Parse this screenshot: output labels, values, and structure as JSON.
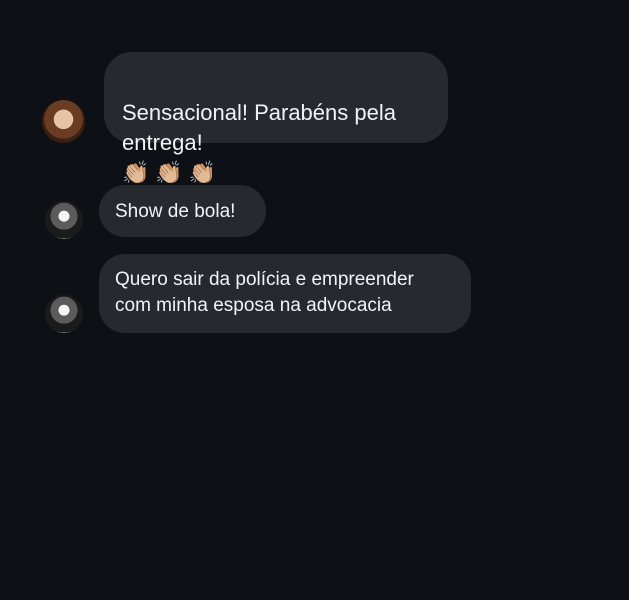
{
  "messages": [
    {
      "text": "Sensacional! Parabéns pela\nentrega!",
      "emoji": "👏🏼👏🏼👏🏼",
      "avatar_icon": "user-avatar-woman-icon"
    },
    {
      "text": "Show de bola!",
      "avatar_icon": "user-avatar-man-icon"
    },
    {
      "text": "Quero sair da polícia e empreender\ncom minha esposa na advocacia",
      "avatar_icon": "user-avatar-man-icon"
    }
  ],
  "colors": {
    "background": "#0d1014",
    "bubble": "#26292e",
    "text": "#f2f3f5"
  }
}
